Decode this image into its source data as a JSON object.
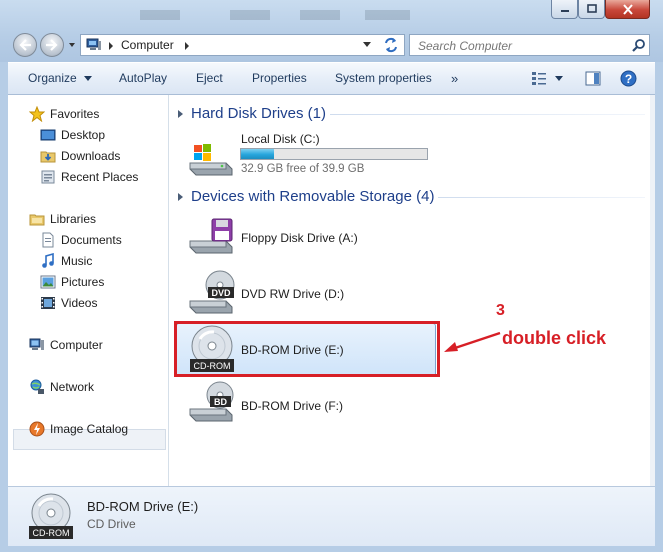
{
  "address": {
    "segments": [
      "Computer"
    ]
  },
  "search": {
    "placeholder": "Search Computer"
  },
  "toolbar": {
    "organize": "Organize",
    "autoplay": "AutoPlay",
    "eject": "Eject",
    "properties": "Properties",
    "system_properties": "System properties",
    "more": "»"
  },
  "nav": {
    "favorites": "Favorites",
    "desktop": "Desktop",
    "downloads": "Downloads",
    "recent": "Recent Places",
    "libraries": "Libraries",
    "documents": "Documents",
    "music": "Music",
    "pictures": "Pictures",
    "videos": "Videos",
    "computer": "Computer",
    "network": "Network",
    "image_catalog": "Image Catalog"
  },
  "groups": {
    "hdd": "Hard Disk Drives (1)",
    "removable": "Devices with Removable Storage (4)"
  },
  "drives": {
    "local": {
      "name": "Local Disk (C:)",
      "free": "32.9 GB free of 39.9 GB",
      "used_fraction": 0.175
    },
    "floppy": {
      "name": "Floppy Disk Drive (A:)"
    },
    "dvd": {
      "name": "DVD RW Drive (D:)",
      "badge": "DVD"
    },
    "bde": {
      "name": "BD-ROM Drive (E:)",
      "badge": "CD-ROM"
    },
    "bdf": {
      "name": "BD-ROM Drive (F:)",
      "badge": "BD"
    }
  },
  "annotation": {
    "step": "3",
    "text": "double click",
    "color": "#d71f26"
  },
  "details": {
    "name": "BD-ROM Drive (E:)",
    "type": "CD Drive",
    "badge": "CD-ROM"
  }
}
